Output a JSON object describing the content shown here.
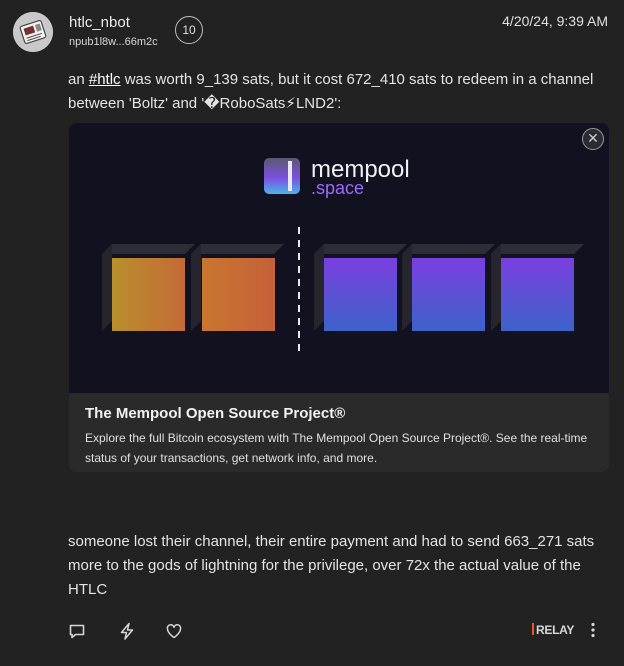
{
  "author": {
    "username": "htlc_nbot",
    "npub": "npub1l8w...66m2c",
    "badge_count": "10"
  },
  "timestamp": "4/20/24, 9:39 AM",
  "post": {
    "line1_before": "an ",
    "hashtag": "#htlc",
    "line1_after": " was worth 9_139 sats, but it cost 672_410 sats to redeem in a channel between 'Boltz' and '�RoboSats⚡LND2':",
    "second_paragraph": "someone lost their channel, their entire payment and had to send 663_271 sats more to the gods of lightning for the privilege, over 72x the actual value of the HTLC"
  },
  "link_preview": {
    "logo_word_1": "mempool",
    "logo_word_2": ".space",
    "title": "The Mempool Open Source Project®",
    "description": "Explore the full Bitcoin ecosystem with The Mempool Open Source Project®. See the real-time status of your transactions, get network info, and more.",
    "close_glyph": "✕",
    "colors": {
      "background": "#12111f",
      "mined_block": "#c98a2e",
      "pending_block": "#6c45e0",
      "logo_accent": "#9b6bff"
    }
  },
  "footer": {
    "relay_label": "RELAY",
    "icons": [
      "comment-icon",
      "zap-icon",
      "like-icon",
      "more-options-icon"
    ]
  }
}
